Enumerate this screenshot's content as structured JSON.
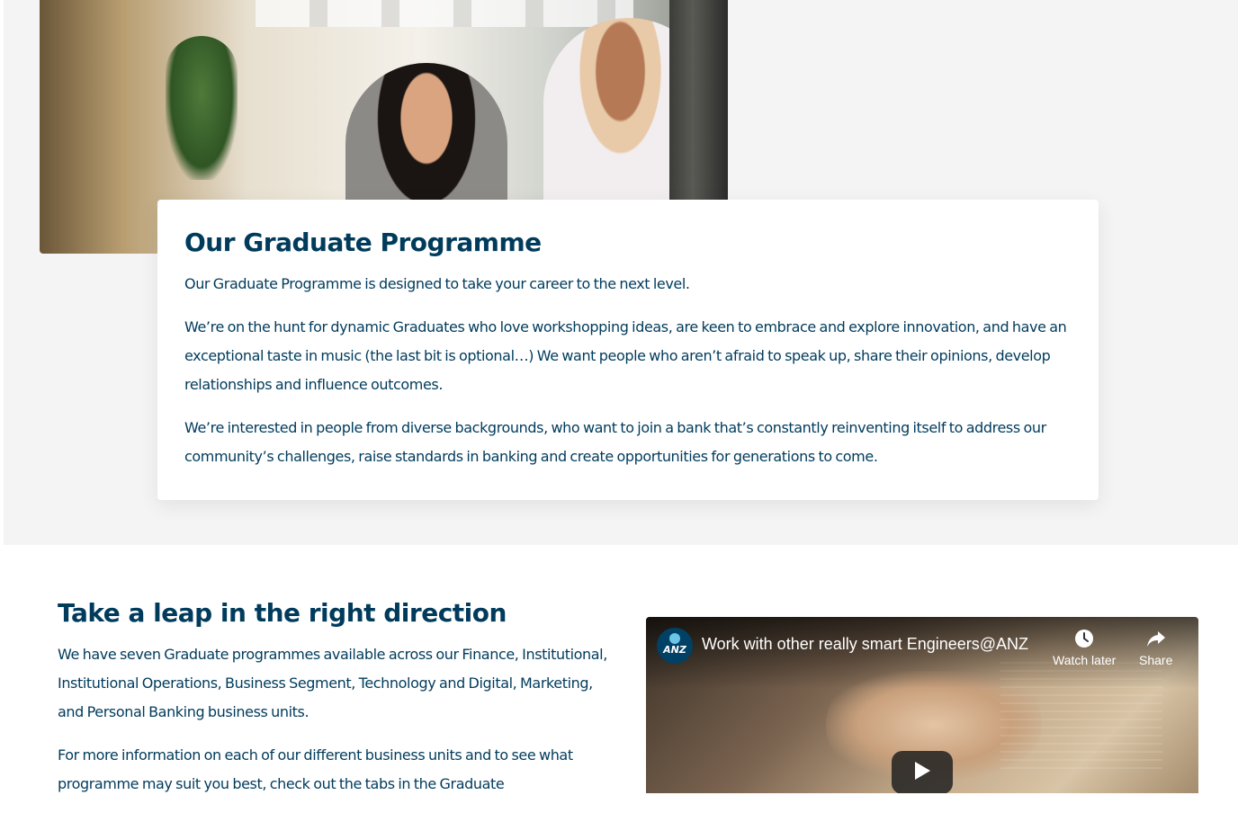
{
  "hero": {
    "image_alt": "Two colleagues talking and smiling in a modern office"
  },
  "programme_card": {
    "title": "Our Graduate Programme",
    "paragraphs": [
      "Our Graduate Programme is designed to take your career to the next level.",
      "We’re on the hunt for dynamic Graduates who love workshopping ideas, are keen to embrace and explore innovation, and have an exceptional taste in music (the last bit is optional…) We want people who aren’t afraid to speak up, share their opinions, develop relationships and influence outcomes.",
      "We’re interested in people from diverse backgrounds, who want to join a bank that’s constantly reinventing itself to address our community’s challenges, raise standards in banking and create opportunities for generations to come."
    ]
  },
  "leap_section": {
    "title": "Take a leap in the right direction",
    "paragraphs": [
      "We have seven Graduate programmes available across our Finance, Institutional, Institutional Operations, Business Segment, Technology and Digital, Marketing, and Personal Banking business units.",
      "For more information on each of our different business units and to see what programme may suit you best, check out the tabs in the Graduate"
    ]
  },
  "video": {
    "channel_logo_text": "ANZ",
    "title": "Work with other really smart Engineers@ANZ",
    "watch_later_label": "Watch later",
    "share_label": "Share",
    "icons": {
      "watch_later": "clock-icon",
      "share": "share-arrow-icon",
      "play": "play-icon"
    }
  },
  "colors": {
    "heading": "#003b5c",
    "band_background": "#f4f4f4",
    "card_background": "#ffffff",
    "channel_logo": "#004165"
  }
}
